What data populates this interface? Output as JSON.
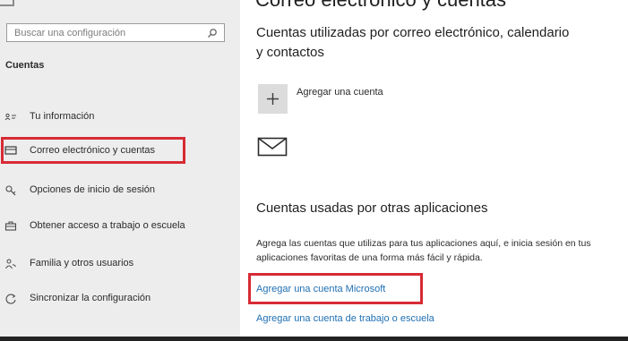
{
  "window": {
    "title": "Correo electrónico y cuentas"
  },
  "sidebar": {
    "search": {
      "placeholder": "Buscar una configuración",
      "icon": "search-icon"
    },
    "section_title": "Cuentas",
    "items": [
      {
        "label": "Tu información",
        "icon": "person-card-icon",
        "selected": false
      },
      {
        "label": "Correo electrónico y cuentas",
        "icon": "mail-icon",
        "selected": true
      },
      {
        "label": "Opciones de inicio de sesión",
        "icon": "key-icon",
        "selected": false
      },
      {
        "label": "Obtener acceso a trabajo o escuela",
        "icon": "briefcase-icon",
        "selected": false
      },
      {
        "label": "Familia y otros usuarios",
        "icon": "people-icon",
        "selected": false
      },
      {
        "label": "Sincronizar la configuración",
        "icon": "sync-icon",
        "selected": false
      }
    ]
  },
  "main": {
    "section1": {
      "heading": "Cuentas utilizadas por correo electrónico, calendario y contactos",
      "add_account": "Agregar una cuenta"
    },
    "section2": {
      "heading": "Cuentas usadas por otras aplicaciones",
      "description": "Agrega las cuentas que utilizas para tus aplicaciones aquí, e inicia sesión en tus aplicaciones favoritas de una forma más fácil y rápida.",
      "links": [
        "Agregar una cuenta Microsoft",
        "Agregar una cuenta de trabajo o escuela"
      ]
    }
  },
  "colors": {
    "highlight": "#d72b35",
    "link": "#1f6fb3",
    "sidebar_bg": "#ededed"
  }
}
